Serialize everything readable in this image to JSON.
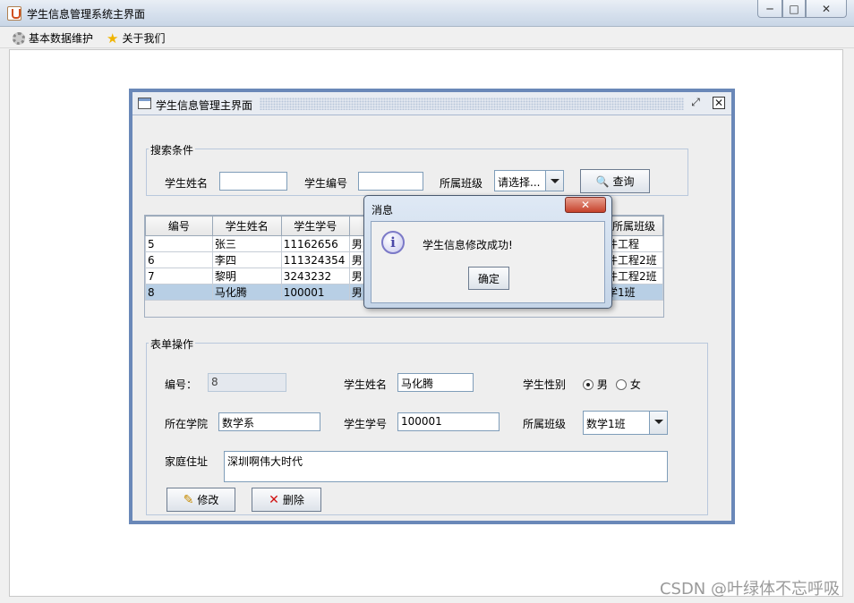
{
  "window": {
    "title": "学生信息管理系统主界面",
    "controls": [
      "─",
      "□",
      "✕"
    ]
  },
  "menu": [
    {
      "label": "基本数据维护",
      "icon": "gear-icon"
    },
    {
      "label": "关于我们",
      "icon": "star-icon"
    }
  ],
  "frame": {
    "title": "学生信息管理主界面"
  },
  "search": {
    "legend": "搜索条件",
    "name_label": "学生姓名",
    "name_value": "",
    "id_label": "学生编号",
    "id_value": "",
    "class_label": "所属班级",
    "class_value": "请选择...",
    "query_button": "查询"
  },
  "table": {
    "headers": [
      "编号",
      "学生姓名",
      "学生学号",
      "",
      "",
      "",
      "所属班级"
    ],
    "rows": [
      [
        "5",
        "张三",
        "11162656",
        "男",
        "",
        "",
        "件工程"
      ],
      [
        "6",
        "李四",
        "111324354",
        "男",
        "",
        "",
        "件工程2班"
      ],
      [
        "7",
        "黎明",
        "3243232",
        "男",
        "",
        "",
        "件工程2班"
      ],
      [
        "8",
        "马化腾",
        "100001",
        "男",
        "",
        "",
        "学1班"
      ]
    ],
    "selected_row": 3
  },
  "form": {
    "legend": "表单操作",
    "id_label": "编号：",
    "id_value": "8",
    "name_label": "学生姓名",
    "name_value": "马化腾",
    "gender_label": "学生性别",
    "gender_male": "男",
    "gender_female": "女",
    "gender_selected": "男",
    "college_label": "所在学院",
    "college_value": "数学系",
    "sno_label": "学生学号",
    "sno_value": "100001",
    "class_label": "所属班级",
    "class_value": "数学1班",
    "address_label": "家庭住址",
    "address_value": "深圳啊伟大时代",
    "edit_button": "修改",
    "delete_button": "删除"
  },
  "dialog": {
    "title": "消息",
    "message": "学生信息修改成功!",
    "ok_button": "确定"
  },
  "watermark": "CSDN @叶绿体不忘呼吸"
}
